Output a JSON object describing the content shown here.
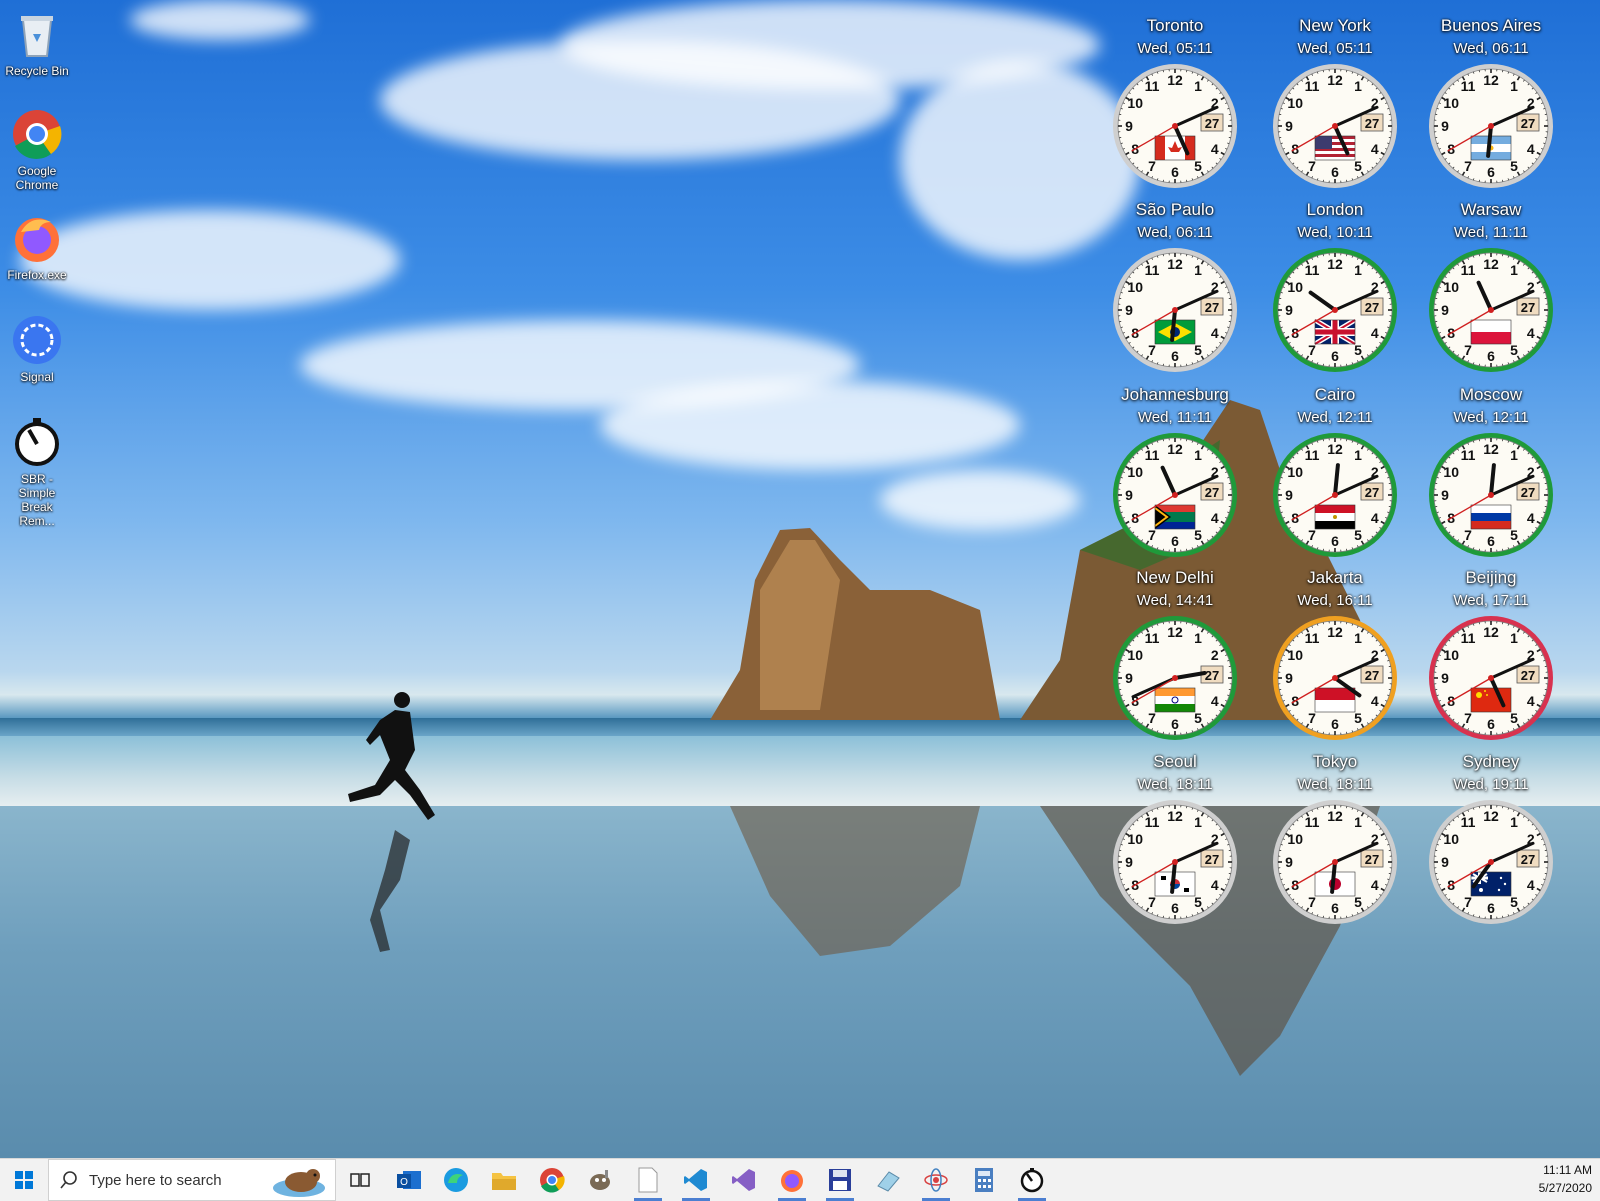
{
  "desktop": {
    "icons": [
      {
        "label": "Recycle Bin",
        "icon": "recycle-bin-icon"
      },
      {
        "label": "Google Chrome",
        "icon": "chrome-icon"
      },
      {
        "label": "Firefox.exe",
        "icon": "firefox-icon"
      },
      {
        "label": "Signal",
        "icon": "signal-icon"
      },
      {
        "label": "SBR - Simple Break Rem...",
        "icon": "timer-icon"
      }
    ]
  },
  "clocks": [
    {
      "city": "Toronto",
      "time": "Wed, 05:11",
      "hour": 5,
      "minute": 11,
      "date": "27",
      "ring": "#cfcfcf",
      "flag": "canada"
    },
    {
      "city": "New York",
      "time": "Wed, 05:11",
      "hour": 5,
      "minute": 11,
      "date": "27",
      "ring": "#cfcfcf",
      "flag": "usa"
    },
    {
      "city": "Buenos Aires",
      "time": "Wed, 06:11",
      "hour": 6,
      "minute": 11,
      "date": "27",
      "ring": "#cfcfcf",
      "flag": "argentina"
    },
    {
      "city": "São Paulo",
      "time": "Wed, 06:11",
      "hour": 6,
      "minute": 11,
      "date": "27",
      "ring": "#cfcfcf",
      "flag": "brazil"
    },
    {
      "city": "London",
      "time": "Wed, 10:11",
      "hour": 10,
      "minute": 11,
      "date": "27",
      "ring": "#1f9a3a",
      "flag": "uk"
    },
    {
      "city": "Warsaw",
      "time": "Wed, 11:11",
      "hour": 11,
      "minute": 11,
      "date": "27",
      "ring": "#1f9a3a",
      "flag": "poland"
    },
    {
      "city": "Johannesburg",
      "time": "Wed, 11:11",
      "hour": 11,
      "minute": 11,
      "date": "27",
      "ring": "#1f9a3a",
      "flag": "southafrica"
    },
    {
      "city": "Cairo",
      "time": "Wed, 12:11",
      "hour": 12,
      "minute": 11,
      "date": "27",
      "ring": "#1f9a3a",
      "flag": "egypt"
    },
    {
      "city": "Moscow",
      "time": "Wed, 12:11",
      "hour": 12,
      "minute": 11,
      "date": "27",
      "ring": "#1f9a3a",
      "flag": "russia"
    },
    {
      "city": "New Delhi",
      "time": "Wed, 14:41",
      "hour": 14,
      "minute": 41,
      "date": "27",
      "ring": "#1f9a3a",
      "flag": "india"
    },
    {
      "city": "Jakarta",
      "time": "Wed, 16:11",
      "hour": 16,
      "minute": 11,
      "date": "27",
      "ring": "#f0a020",
      "flag": "indonesia"
    },
    {
      "city": "Beijing",
      "time": "Wed, 17:11",
      "hour": 17,
      "minute": 11,
      "date": "27",
      "ring": "#d8324f",
      "flag": "china"
    },
    {
      "city": "Seoul",
      "time": "Wed, 18:11",
      "hour": 18,
      "minute": 11,
      "date": "27",
      "ring": "#cfcfcf",
      "flag": "korea"
    },
    {
      "city": "Tokyo",
      "time": "Wed, 18:11",
      "hour": 18,
      "minute": 11,
      "date": "27",
      "ring": "#cfcfcf",
      "flag": "japan"
    },
    {
      "city": "Sydney",
      "time": "Wed, 19:11",
      "hour": 19,
      "minute": 11,
      "date": "27",
      "ring": "#cfcfcf",
      "flag": "australia"
    }
  ],
  "taskbar": {
    "search_placeholder": "Type here to search",
    "apps": [
      {
        "name": "start",
        "icon": "windows-start-icon"
      },
      {
        "name": "task-view",
        "icon": "task-view-icon"
      },
      {
        "name": "outlook",
        "icon": "outlook-icon"
      },
      {
        "name": "edge",
        "icon": "edge-icon"
      },
      {
        "name": "file-explorer",
        "icon": "folder-icon"
      },
      {
        "name": "chrome",
        "icon": "chrome-icon"
      },
      {
        "name": "gimp",
        "icon": "gimp-icon"
      },
      {
        "name": "notepad",
        "icon": "document-icon"
      },
      {
        "name": "vscode",
        "icon": "vscode-icon"
      },
      {
        "name": "visual-studio",
        "icon": "visual-studio-icon"
      },
      {
        "name": "firefox",
        "icon": "firefox-icon"
      },
      {
        "name": "save-app",
        "icon": "floppy-icon"
      },
      {
        "name": "eraser-app",
        "icon": "eraser-icon"
      },
      {
        "name": "network-app",
        "icon": "network-icon"
      },
      {
        "name": "calculator",
        "icon": "calculator-icon"
      },
      {
        "name": "sbr-timer",
        "icon": "timer-icon"
      }
    ],
    "clock_time": "11:11 AM",
    "clock_date": "5/27/2020"
  }
}
